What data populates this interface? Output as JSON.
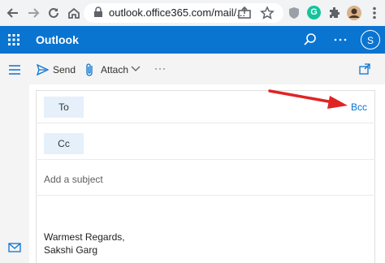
{
  "browser": {
    "url": "outlook.office365.com/mail/...",
    "icons": [
      "back-icon",
      "forward-icon",
      "reload-icon",
      "home-icon",
      "lock-icon",
      "share-icon",
      "star-icon",
      "shield-icon",
      "grammarly-icon",
      "extensions-icon",
      "profile-avatar",
      "more-vert-icon"
    ],
    "grammarly_glyph": "G"
  },
  "suite": {
    "app_title": "Outlook",
    "avatar_initial": "S",
    "icons": [
      "app-launcher-icon",
      "search-icon",
      "more-icon"
    ]
  },
  "command_bar": {
    "send_label": "Send",
    "attach_label": "Attach",
    "more_label": "···",
    "icons": [
      "hamburger-icon",
      "send-icon",
      "paperclip-icon",
      "chevron-down-icon",
      "popout-icon"
    ]
  },
  "compose": {
    "to_label": "To",
    "cc_label": "Cc",
    "bcc_label": "Bcc",
    "subject_placeholder": "Add a subject",
    "signature_line1": "Warmest Regards,",
    "signature_line2": "Sakshi Garg"
  },
  "colors": {
    "brand": "#0a74d1",
    "recipient_button_bg": "#e6f0fb",
    "annotation_arrow": "#e02424"
  },
  "left_rail": {
    "icons": [
      "mail-icon"
    ]
  }
}
